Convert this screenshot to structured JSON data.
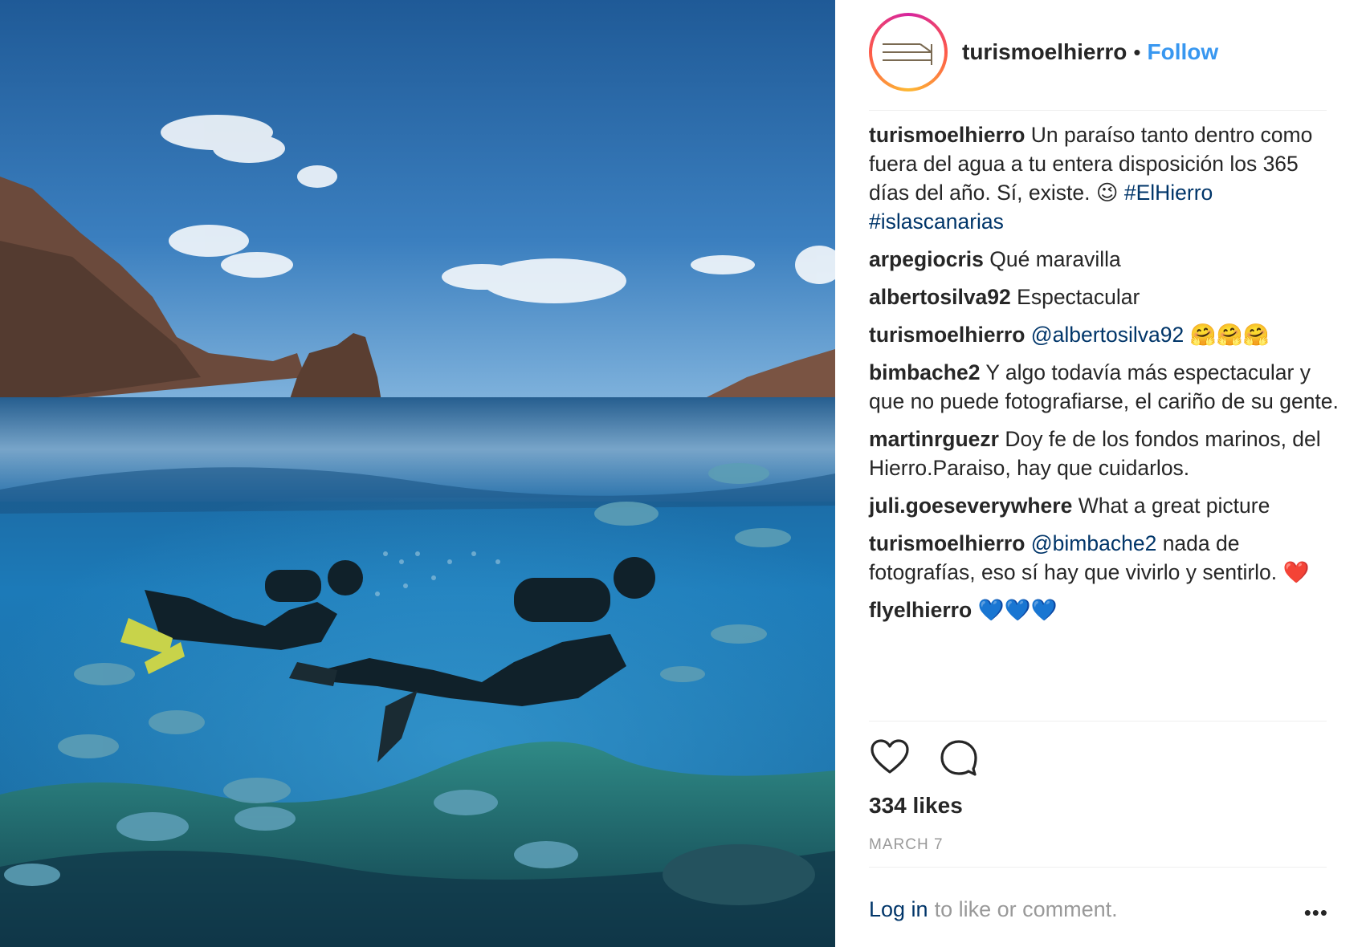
{
  "header": {
    "username": "turismoelhierro",
    "separator": "•",
    "follow_label": "Follow"
  },
  "comments": [
    {
      "user": "turismoelhierro",
      "text": "Un paraíso tanto dentro como fuera del agua a tu entera disposición los 365 días del año. Sí, existe. 😉",
      "tags": "#ElHierro #islascanarias"
    },
    {
      "user": "arpegiocris",
      "text": "Qué maravilla"
    },
    {
      "user": "albertosilva92",
      "text": "Espectacular"
    },
    {
      "user": "turismoelhierro",
      "mention": "@albertosilva92",
      "text": "🤗🤗🤗"
    },
    {
      "user": "bimbache2",
      "text": "Y algo todavía más espectacular y que no puede fotografiarse, el cariño de su gente."
    },
    {
      "user": "martinrguezr",
      "text": "Doy fe de los fondos marinos, del Hierro.Paraiso, hay que cuidarlos."
    },
    {
      "user": "juli.goeseverywhere",
      "text": "What a great picture"
    },
    {
      "user": "turismoelhierro",
      "mention": "@bimbache2",
      "text": "nada de fotografías, eso sí hay que vivirlo y sentirlo. ❤️"
    },
    {
      "user": "flyelhierro",
      "text": "💙💙💙"
    }
  ],
  "likes": "334 likes",
  "date": "MARCH 7",
  "footer": {
    "login_label": "Log in",
    "prompt": "to like or comment.",
    "more_label": "•••"
  },
  "icons": {
    "like": "heart-icon",
    "comment": "comment-bubble-icon",
    "more": "more-options-icon"
  },
  "colors": {
    "follow": "#3897f0",
    "link": "#003569",
    "muted": "#999999"
  }
}
